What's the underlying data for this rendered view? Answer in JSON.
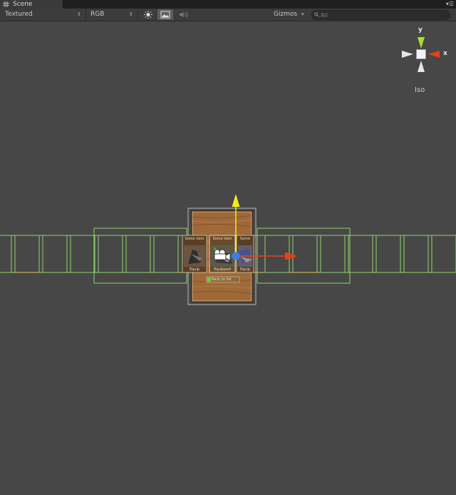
{
  "tab": {
    "title": "Scene"
  },
  "toolbar": {
    "draw_mode": "Textured",
    "render_mode": "RGB",
    "gizmos_label": "Gizmos"
  },
  "search": {
    "placeholder": "All"
  },
  "view_gizmo": {
    "axis_y": "y",
    "axis_x": "x",
    "projection": "Iso"
  },
  "scene": {
    "items": [
      {
        "title": "Some item",
        "footer": "Equip"
      },
      {
        "title": "Some item",
        "footer": "Equipped"
      },
      {
        "title": "Some",
        "footer": "Equip"
      }
    ],
    "button_text": "Back to list"
  },
  "colors": {
    "background": "#474747",
    "toolbar": "#3c3c3c",
    "axis_x": "#e8401a",
    "axis_y": "#f2ea1c",
    "axis_y_gizmo": "#a4e02c",
    "pivot": "#3f7cf2",
    "outline_green": "#8fd36a",
    "outline_yellow": "#d8c84a"
  }
}
